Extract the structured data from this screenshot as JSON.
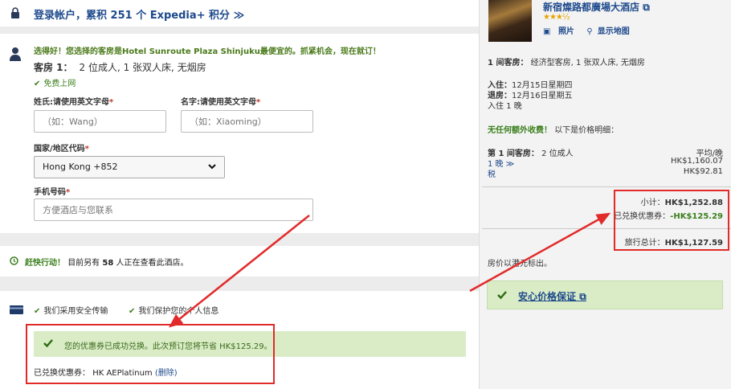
{
  "login": {
    "text": "登录帐户，累积 251 个 Expedia+ 积分 ≫"
  },
  "guest": {
    "headline": "选得好！您选择的客房是Hotel Sunroute Plaza Shinjuku最便宜的。抓紧机会，现在就订！",
    "room_label": "客房 1：",
    "room_desc": "2 位成人, 1 张双人床, 无烟房",
    "wifi": "免费上网",
    "last_name_label": "姓氏:请使用英文字母",
    "last_name_placeholder": "（如：Wang）",
    "first_name_label": "名字:请使用英文字母",
    "first_name_placeholder": "（如：Xiaoming）",
    "country_label": "国家/地区代码",
    "country_value": "Hong Kong +852",
    "phone_label": "手机号码",
    "phone_placeholder": "方便酒店与您联系",
    "required_mark": "*"
  },
  "urgency": {
    "lead": "赶快行动！",
    "before": "目前另有",
    "count": "58",
    "after": "人正在查看此酒店。"
  },
  "security": {
    "item1": "我们采用安全传输",
    "item2": "我们保护您的个人信息",
    "success": "您的优惠券已成功兑换。此次预订您将节省 HK$125.29。",
    "coupon_label": "已兑换优惠券：",
    "coupon_value": "HK AEPlatinum",
    "remove_link": "(删除)"
  },
  "hotel": {
    "name": "新宿燦路都廣場大酒店",
    "stars": "★★★½",
    "photos_link": "照片",
    "map_link": "显示地图"
  },
  "summary": {
    "room_line_label": "1 间客房：",
    "room_line_value": "经济型客房, 1 张双人床, 无烟房",
    "checkin_label": "入住：",
    "checkin_value": "12月15日星期四",
    "checkout_label": "退房：",
    "checkout_value": "12月16日星期五",
    "nights": "入住 1 晚",
    "no_fee_bold": "无任何额外收费！",
    "no_fee_rest": "以下是价格明细：",
    "room1_label": "第 1 间客房：",
    "room1_guests": "2 位成人",
    "avg_label": "平均/晚",
    "nights_link": "1 晚 ≫",
    "nights_price": "HK$1,160.07",
    "tax_link": "税",
    "tax_price": "HK$92.81",
    "subtotal_label": "小计：",
    "subtotal_value": "HK$1,252.88",
    "coupon_label": "已兑换优惠券：",
    "coupon_value": "-HK$125.29",
    "total_label": "旅行总计：",
    "total_value": "HK$1,127.59",
    "currency_note": "房价以港元标出。",
    "guarantee": "安心价格保证"
  },
  "colors": {
    "link_blue": "#1e4a8c",
    "success_green": "#3a7f1c",
    "success_bg": "#d9ecc6",
    "highlight_red": "#e22a2a"
  }
}
